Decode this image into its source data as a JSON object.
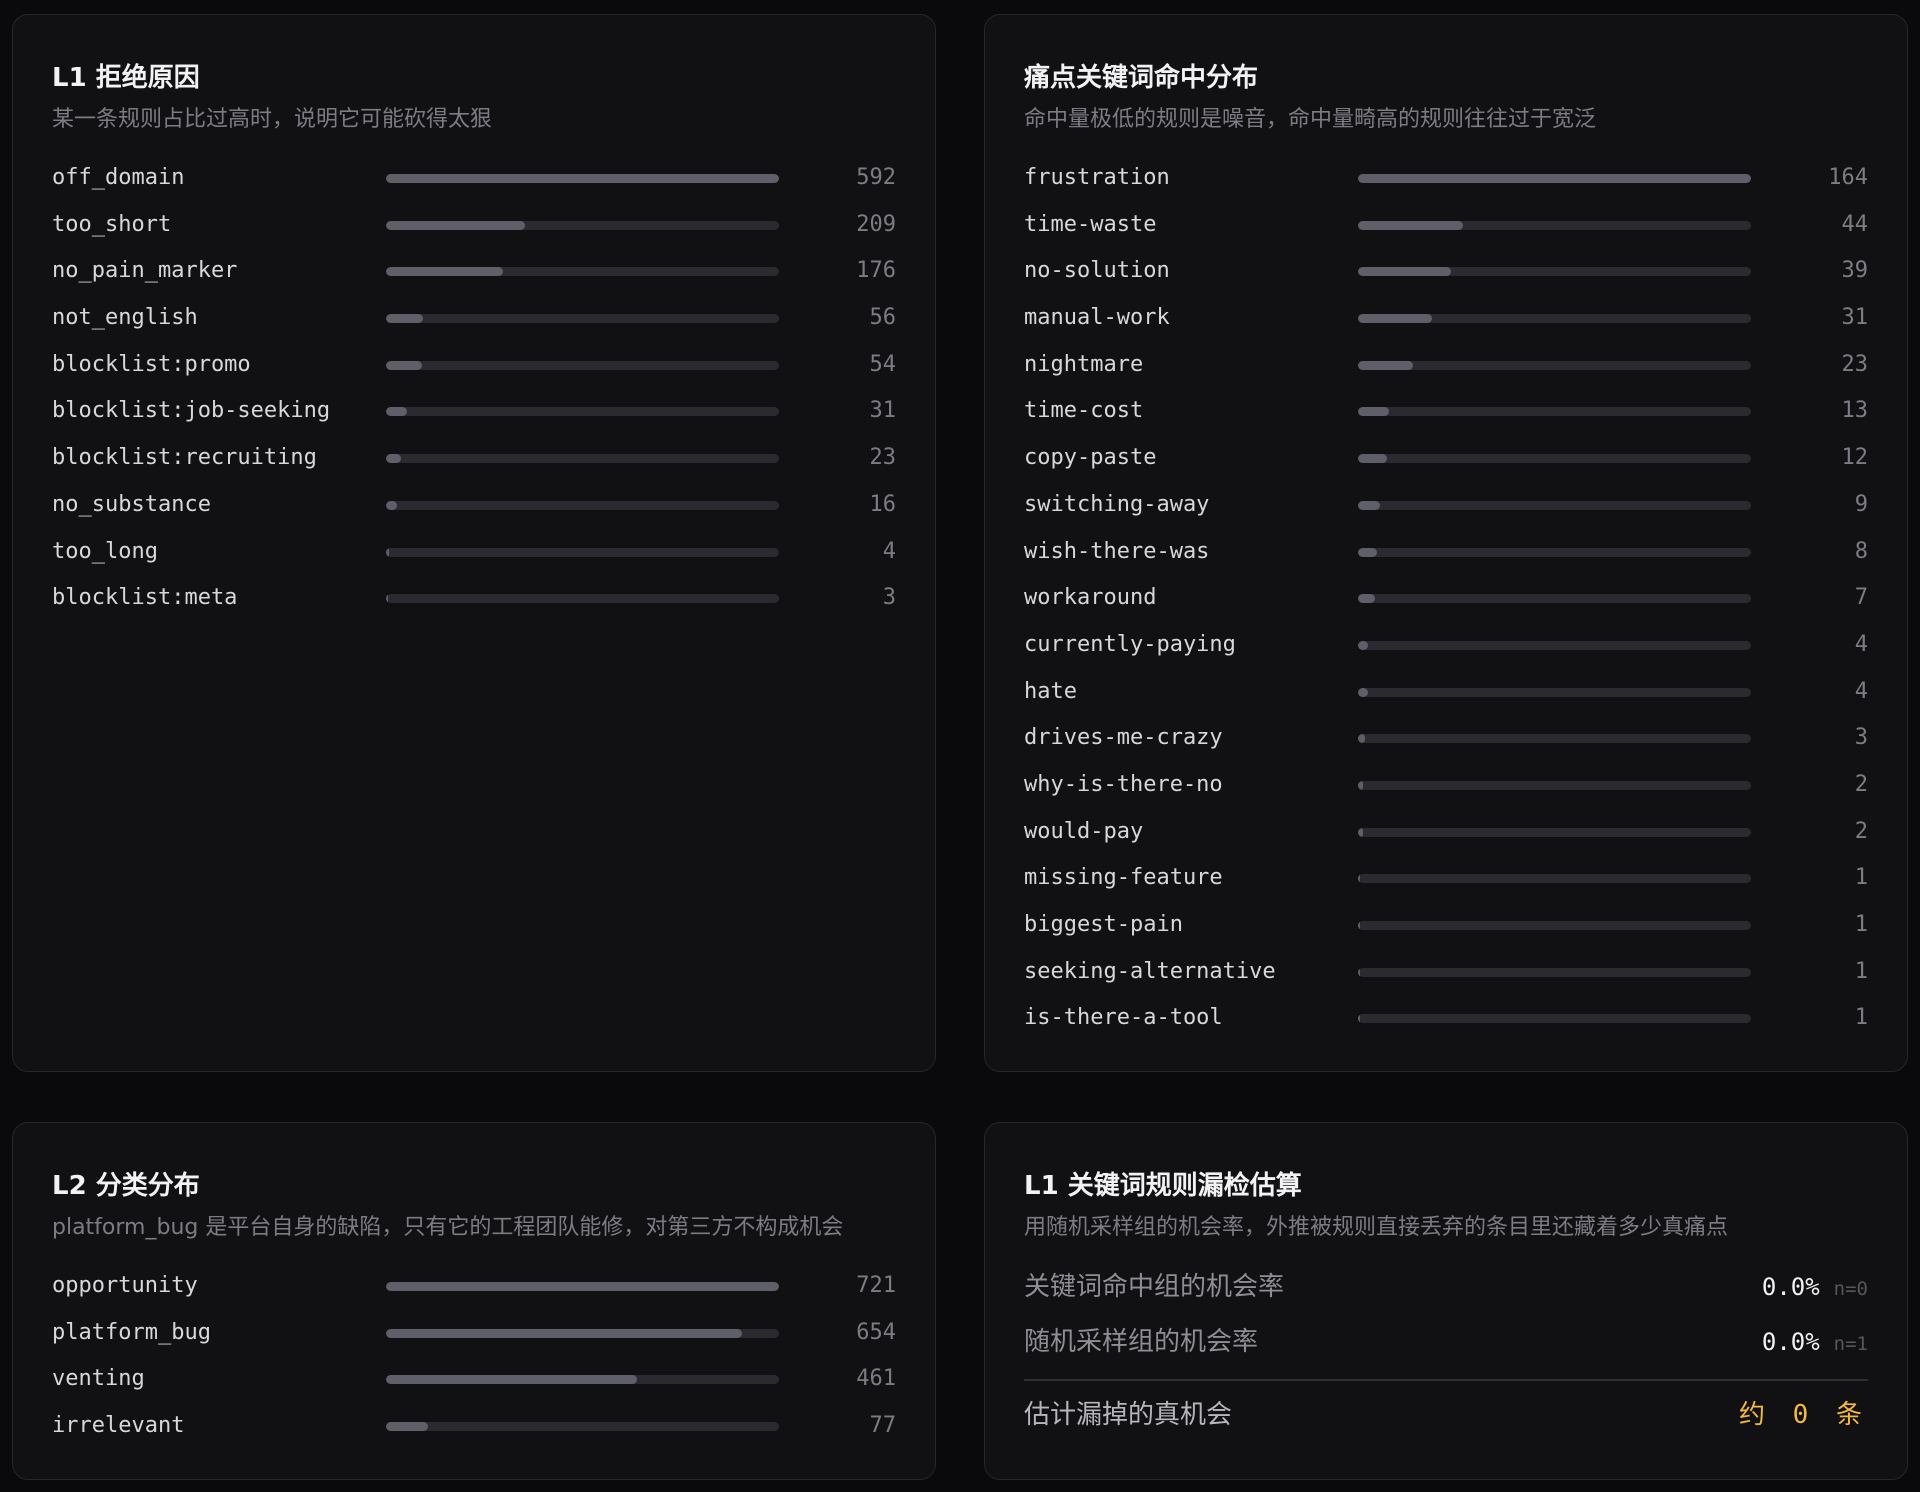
{
  "l1_rejections": {
    "title": "L1 拒绝原因",
    "subtitle": "某一条规则占比过高时，说明它可能砍得太狠",
    "max": 592,
    "rows": [
      {
        "label": "off_domain",
        "value": 592
      },
      {
        "label": "too_short",
        "value": 209
      },
      {
        "label": "no_pain_marker",
        "value": 176
      },
      {
        "label": "not_english",
        "value": 56
      },
      {
        "label": "blocklist:promo",
        "value": 54
      },
      {
        "label": "blocklist:job-seeking",
        "value": 31
      },
      {
        "label": "blocklist:recruiting",
        "value": 23
      },
      {
        "label": "no_substance",
        "value": 16
      },
      {
        "label": "too_long",
        "value": 4
      },
      {
        "label": "blocklist:meta",
        "value": 3
      }
    ]
  },
  "pain_keywords": {
    "title": "痛点关键词命中分布",
    "subtitle": "命中量极低的规则是噪音，命中量畸高的规则往往过于宽泛",
    "max": 164,
    "rows": [
      {
        "label": "frustration",
        "value": 164
      },
      {
        "label": "time-waste",
        "value": 44
      },
      {
        "label": "no-solution",
        "value": 39
      },
      {
        "label": "manual-work",
        "value": 31
      },
      {
        "label": "nightmare",
        "value": 23
      },
      {
        "label": "time-cost",
        "value": 13
      },
      {
        "label": "copy-paste",
        "value": 12
      },
      {
        "label": "switching-away",
        "value": 9
      },
      {
        "label": "wish-there-was",
        "value": 8
      },
      {
        "label": "workaround",
        "value": 7
      },
      {
        "label": "currently-paying",
        "value": 4
      },
      {
        "label": "hate",
        "value": 4
      },
      {
        "label": "drives-me-crazy",
        "value": 3
      },
      {
        "label": "why-is-there-no",
        "value": 2
      },
      {
        "label": "would-pay",
        "value": 2
      },
      {
        "label": "missing-feature",
        "value": 1
      },
      {
        "label": "biggest-pain",
        "value": 1
      },
      {
        "label": "seeking-alternative",
        "value": 1
      },
      {
        "label": "is-there-a-tool",
        "value": 1
      }
    ]
  },
  "l2_categories": {
    "title": "L2 分类分布",
    "subtitle": "platform_bug 是平台自身的缺陷，只有它的工程团队能修，对第三方不构成机会",
    "max": 721,
    "rows": [
      {
        "label": "opportunity",
        "value": 721
      },
      {
        "label": "platform_bug",
        "value": 654
      },
      {
        "label": "venting",
        "value": 461
      },
      {
        "label": "irrelevant",
        "value": 77
      }
    ]
  },
  "l1_estimate": {
    "title": "L1 关键词规则漏检估算",
    "subtitle": "用随机采样组的机会率，外推被规则直接丢弃的条目里还藏着多少真痛点",
    "keyword_group": {
      "label": "关键词命中组的机会率",
      "value": "0.0%",
      "n": "n=0"
    },
    "random_group": {
      "label": "随机采样组的机会率",
      "value": "0.0%",
      "n": "n=1"
    },
    "estimate": {
      "label": "估计漏掉的真机会",
      "value": "约 0 条"
    },
    "accent_color": "#f5b942"
  }
}
